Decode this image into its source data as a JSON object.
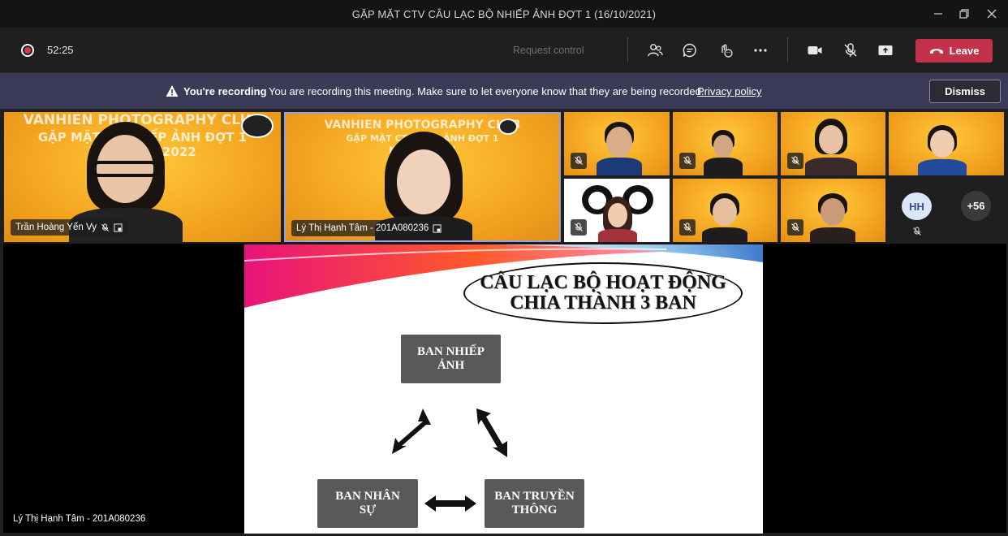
{
  "window": {
    "title": "GẶP MẶT CTV CÂU LẠC BỘ NHIẾP ẢNH ĐỢT 1 (16/10/2021)",
    "minimize_icon": "minimize-icon",
    "restore_icon": "restore-icon",
    "close_icon": "close-icon"
  },
  "toolbar": {
    "timer": "52:25",
    "request_control": "Request control",
    "leave_label": "Leave",
    "colors": {
      "leave": "#c4314b",
      "recording": "#e0353b"
    }
  },
  "banner": {
    "title": "You're recording",
    "message": "You are recording this meeting. Make sure to let everyone know that they are being recorded.",
    "link": "Privacy policy",
    "dismiss": "Dismiss",
    "color": "#3b3a58"
  },
  "gallery": {
    "tiles": [
      {
        "name": "Trần Hoàng Yến Vy",
        "club": "VANHIEN PHOTOGRAPHY CLUB",
        "line2": "GẶP MẶT CTV ...ẾP ẢNH ĐỢT 1",
        "line3": "NĂM H... - 2022"
      },
      {
        "name": "Lý Thị Hạnh Tâm - 201A080236",
        "club": "VANHIEN PHOTOGRAPHY CLUB",
        "line2": "GẶP MẶT CTV CL... ẢNH ĐỢT 1",
        "line3": "NĂM HỌ... 22"
      }
    ],
    "overflow_avatar": "HH",
    "overflow_count": "+56"
  },
  "slide": {
    "title_line1": "CÂU LẠC BỘ HOẠT ĐỘNG",
    "title_line2": "CHIA THÀNH 3 BAN",
    "box_top": [
      "BAN NHIẾP",
      "ẢNH"
    ],
    "box_left": [
      "BAN NHÂN",
      "SỰ"
    ],
    "box_right": [
      "BAN TRUYỀN",
      "THÔNG"
    ]
  },
  "stage": {
    "presenter": "Lý Thị Hạnh Tâm - 201A080236"
  }
}
